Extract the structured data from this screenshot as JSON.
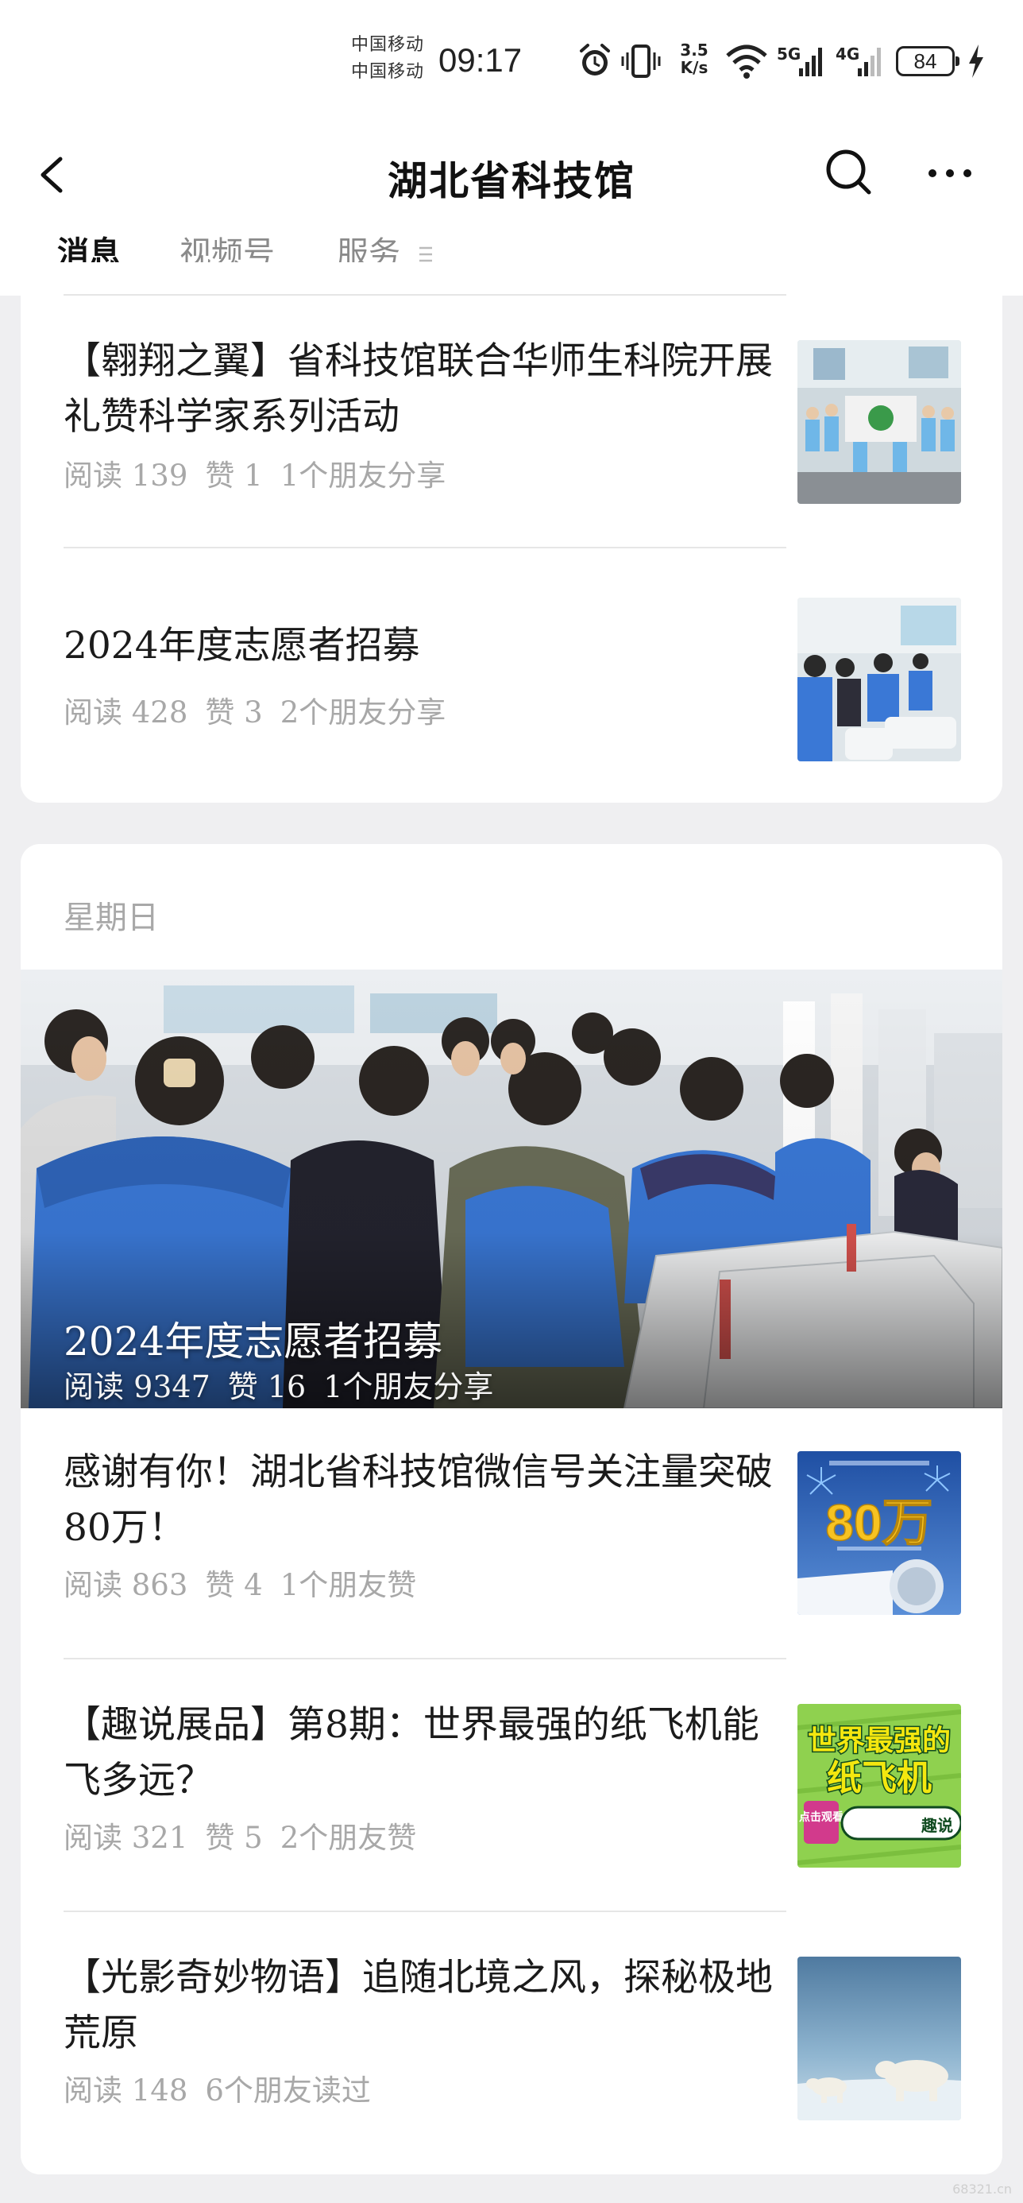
{
  "status_bar": {
    "carrier_1": "中国移动",
    "carrier_2": "中国移动",
    "time": "09:17",
    "net_speed_value": "3.5",
    "net_speed_unit": "K/s",
    "network_1": "5G",
    "network_2": "4G",
    "battery": "84"
  },
  "header": {
    "title": "湖北省科技馆"
  },
  "tabs": [
    {
      "label": "消息",
      "active": true
    },
    {
      "label": "视频号",
      "active": false
    },
    {
      "label": "服务",
      "active": false
    }
  ],
  "card1": {
    "articles": [
      {
        "title": "【翱翔之翼】省科技馆联合华师生科院开展礼赞科学家系列活动",
        "reads": "阅读 139",
        "likes": "赞 1",
        "social": "1个朋友分享"
      },
      {
        "title": "2024年度志愿者招募",
        "reads": "阅读 428",
        "likes": "赞 3",
        "social": "2个朋友分享"
      }
    ]
  },
  "card2": {
    "day": "星期日",
    "hero": {
      "title": "2024年度志愿者招募",
      "reads": "阅读 9347",
      "likes": "赞 16",
      "social": "1个朋友分享"
    },
    "articles": [
      {
        "title": "感谢有你！湖北省科技馆微信号关注量突破80万！",
        "reads": "阅读 863",
        "likes": "赞 4",
        "social": "1个朋友赞",
        "thumb_text": "80万"
      },
      {
        "title": "【趣说展品】第8期：世界最强的纸飞机能飞多远？",
        "reads": "阅读 321",
        "likes": "赞 5",
        "social": "2个朋友赞",
        "thumb_text_1": "世界最强的",
        "thumb_text_2": "纸飞机",
        "thumb_text_3": "趣说",
        "thumb_text_4": "点击观看"
      },
      {
        "title": "【光影奇妙物语】追随北境之风，探秘极地荒原",
        "reads": "阅读 148",
        "social": "6个朋友读过"
      }
    ]
  },
  "watermark": "68321.cn",
  "colors": {
    "background": "#efeff1",
    "card": "#ffffff",
    "meta_text": "#a8a8a8",
    "volunteer_blue": "#3a78d6"
  }
}
